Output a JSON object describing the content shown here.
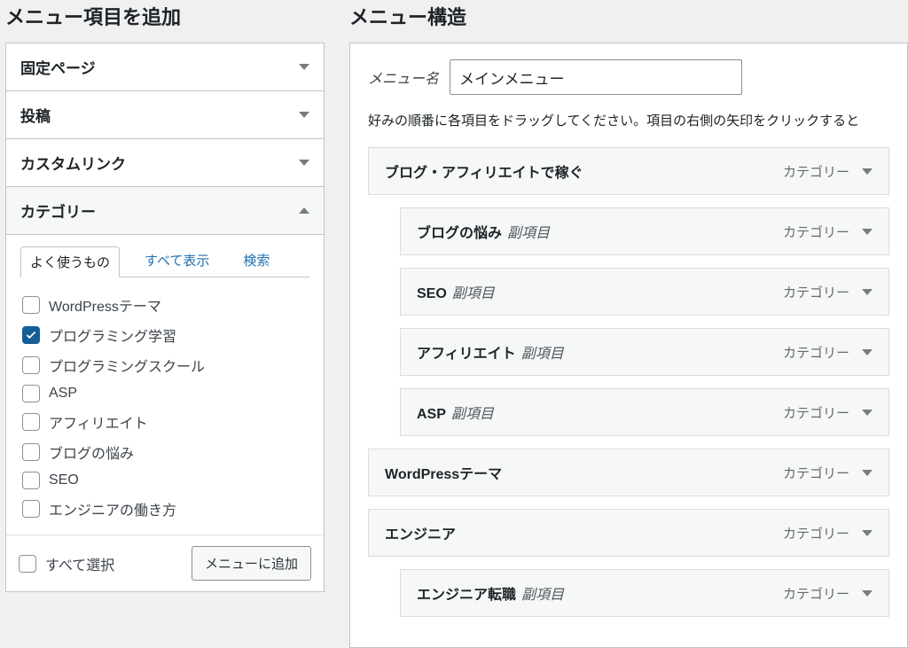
{
  "left": {
    "title": "メニュー項目を追加",
    "panels": [
      {
        "label": "固定ページ",
        "open": false
      },
      {
        "label": "投稿",
        "open": false
      },
      {
        "label": "カスタムリンク",
        "open": false
      },
      {
        "label": "カテゴリー",
        "open": true
      }
    ],
    "tabs": {
      "frequent": "よく使うもの",
      "all": "すべて表示",
      "search": "検索"
    },
    "categories": [
      {
        "label": "WordPressテーマ",
        "checked": false
      },
      {
        "label": "プログラミング学習",
        "checked": true
      },
      {
        "label": "プログラミングスクール",
        "checked": false
      },
      {
        "label": "ASP",
        "checked": false
      },
      {
        "label": "アフィリエイト",
        "checked": false
      },
      {
        "label": "ブログの悩み",
        "checked": false
      },
      {
        "label": "SEO",
        "checked": false
      },
      {
        "label": "エンジニアの働き方",
        "checked": false
      }
    ],
    "select_all": "すべて選択",
    "add_button": "メニューに追加"
  },
  "right": {
    "title": "メニュー構造",
    "name_label": "メニュー名",
    "name_value": "メインメニュー",
    "hint": "好みの順番に各項目をドラッグしてください。項目の右側の矢印をクリックすると",
    "type_label": "カテゴリー",
    "sub_label": "副項目",
    "items": [
      {
        "label": "ブログ・アフィリエイトで稼ぐ",
        "sub": false,
        "indent": 0
      },
      {
        "label": "ブログの悩み",
        "sub": true,
        "indent": 1
      },
      {
        "label": "SEO",
        "sub": true,
        "indent": 1
      },
      {
        "label": "アフィリエイト",
        "sub": true,
        "indent": 1
      },
      {
        "label": "ASP",
        "sub": true,
        "indent": 1
      },
      {
        "label": "WordPressテーマ",
        "sub": false,
        "indent": 0
      },
      {
        "label": "エンジニア",
        "sub": false,
        "indent": 0
      },
      {
        "label": "エンジニア転職",
        "sub": true,
        "indent": 1
      }
    ]
  }
}
